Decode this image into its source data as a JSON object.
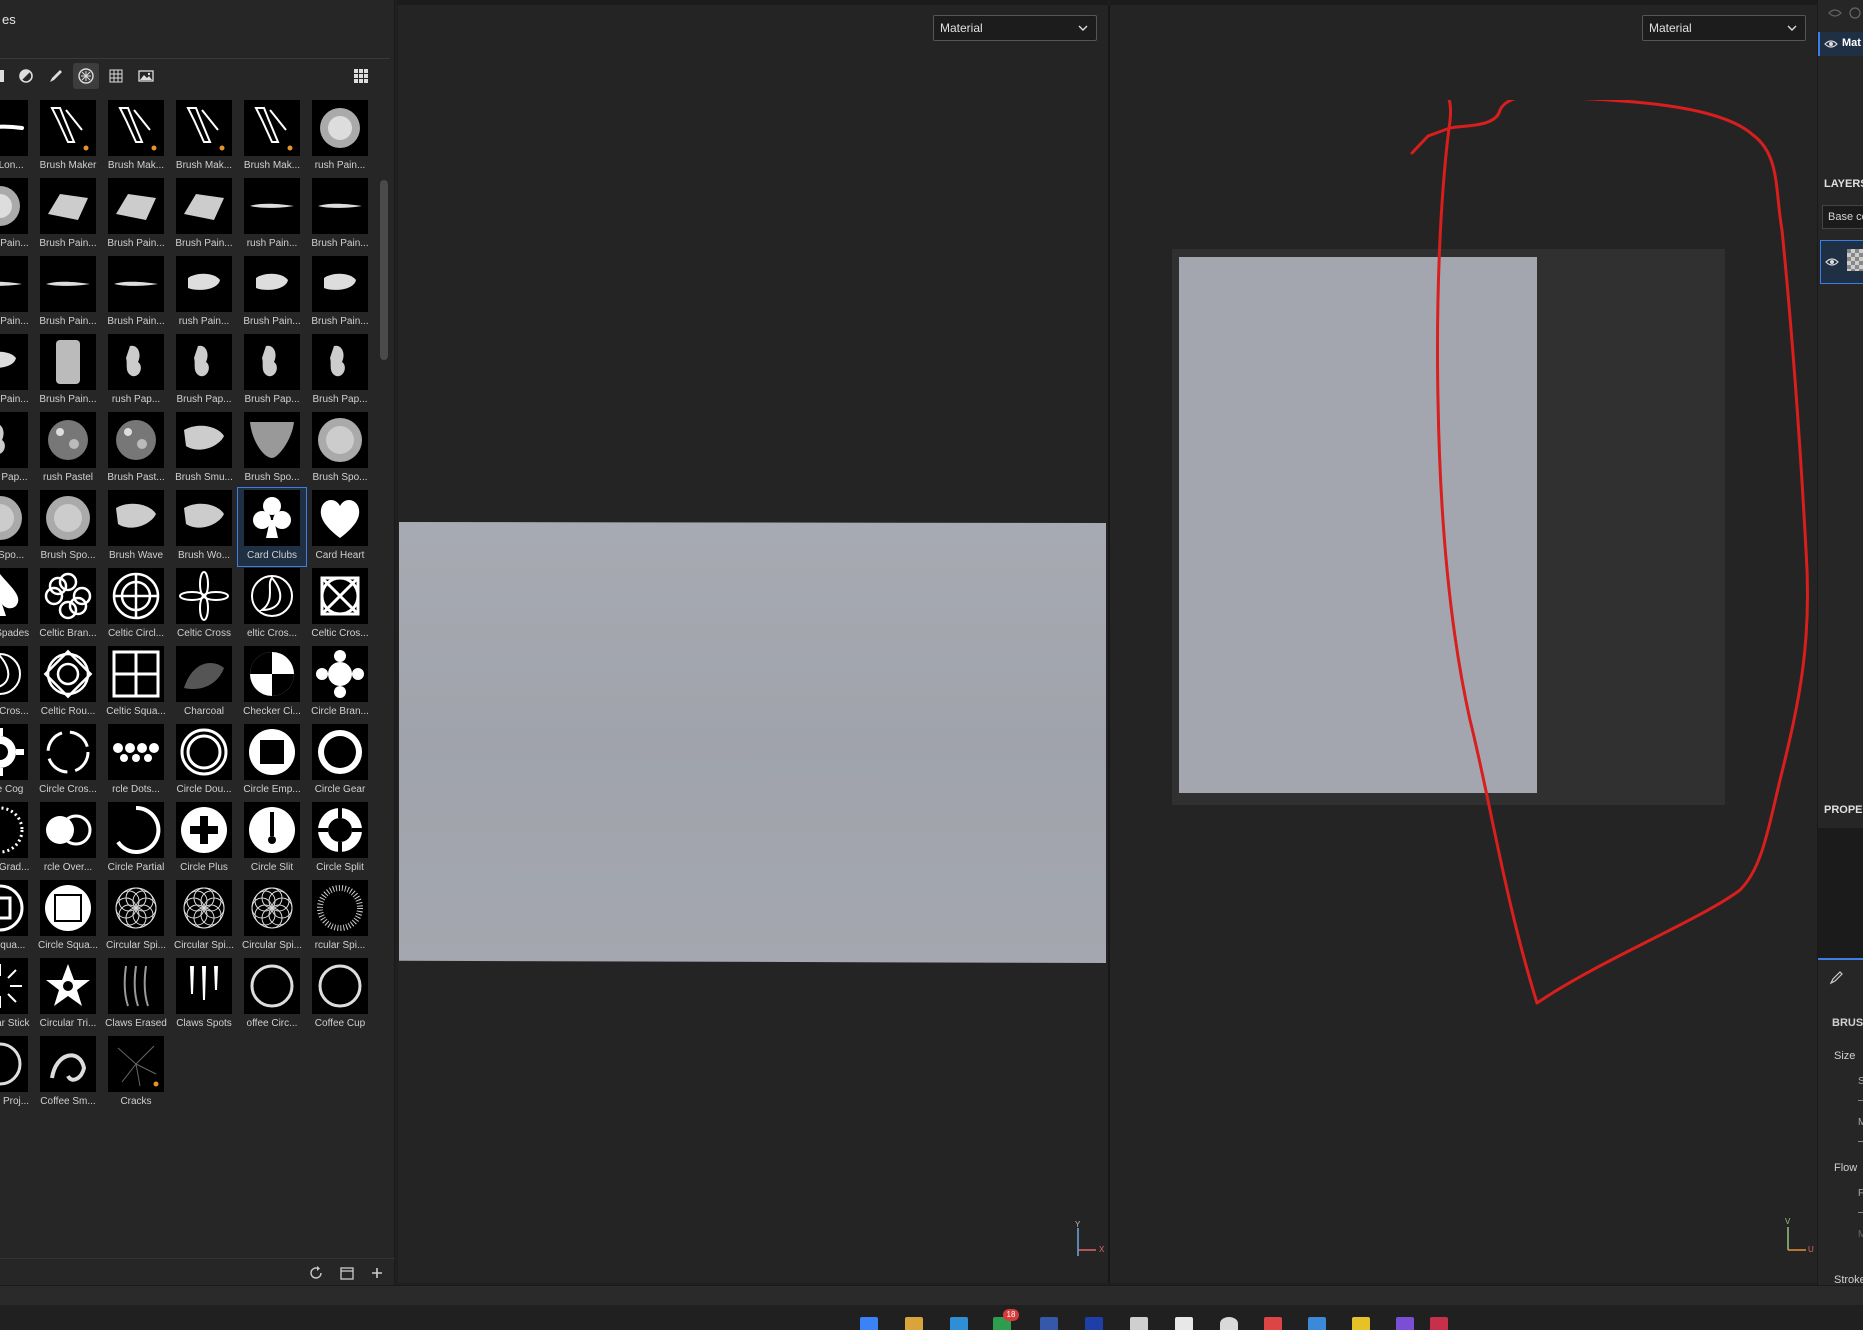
{
  "shelf": {
    "title": "es",
    "toolbar": [
      "material-icon",
      "filter-icon",
      "brush-icon",
      "alpha-icon",
      "grid-pattern-icon",
      "environment-icon"
    ],
    "selected_tile": "Card Clubs",
    "tiles": [
      {
        "label": "rush Lon...",
        "icon": "stroke"
      },
      {
        "label": "Brush Maker",
        "icon": "brushmaker"
      },
      {
        "label": "Brush Mak...",
        "icon": "brushmaker"
      },
      {
        "label": "Brush Mak...",
        "icon": "brushmaker"
      },
      {
        "label": "Brush Mak...",
        "icon": "brushmaker"
      },
      {
        "label": "rush Pain...",
        "icon": "paint-blob"
      },
      {
        "label": "Brush Pain...",
        "icon": "paint-blob"
      },
      {
        "label": "Brush Pain...",
        "icon": "paint-stroke"
      },
      {
        "label": "Brush Pain...",
        "icon": "paint-stroke"
      },
      {
        "label": "Brush Pain...",
        "icon": "paint-stroke"
      },
      {
        "label": "rush Pain...",
        "icon": "thin-stroke"
      },
      {
        "label": "Brush Pain...",
        "icon": "thin-stroke"
      },
      {
        "label": "Brush Pain...",
        "icon": "thin-stroke"
      },
      {
        "label": "Brush Pain...",
        "icon": "thin-stroke"
      },
      {
        "label": "Brush Pain...",
        "icon": "thin-stroke"
      },
      {
        "label": "rush Pain...",
        "icon": "small-blob"
      },
      {
        "label": "Brush Pain...",
        "icon": "small-blob"
      },
      {
        "label": "Brush Pain...",
        "icon": "small-blob"
      },
      {
        "label": "Brush Pain...",
        "icon": "small-blob"
      },
      {
        "label": "Brush Pain...",
        "icon": "tall-blob"
      },
      {
        "label": "rush Pap...",
        "icon": "splat"
      },
      {
        "label": "Brush Pap...",
        "icon": "splat"
      },
      {
        "label": "Brush Pap...",
        "icon": "splat"
      },
      {
        "label": "Brush Pap...",
        "icon": "splat"
      },
      {
        "label": "Brush Pap...",
        "icon": "splat"
      },
      {
        "label": "rush Pastel",
        "icon": "noise"
      },
      {
        "label": "Brush Past...",
        "icon": "noise"
      },
      {
        "label": "Brush Smu...",
        "icon": "smudge"
      },
      {
        "label": "Brush Spo...",
        "icon": "sponge-half"
      },
      {
        "label": "Brush Spo...",
        "icon": "sponge"
      },
      {
        "label": "rush Spo...",
        "icon": "sponge"
      },
      {
        "label": "Brush Spo...",
        "icon": "sponge"
      },
      {
        "label": "Brush Wave",
        "icon": "smudge"
      },
      {
        "label": "Brush Wo...",
        "icon": "smudge"
      },
      {
        "label": "Card Clubs",
        "icon": "club"
      },
      {
        "label": "Card Heart",
        "icon": "heart"
      },
      {
        "label": "Card Spades",
        "icon": "spade"
      },
      {
        "label": "Celtic Bran...",
        "icon": "celtic-flower"
      },
      {
        "label": "Celtic Circl...",
        "icon": "celtic-circle"
      },
      {
        "label": "Celtic Cross",
        "icon": "celtic-star"
      },
      {
        "label": "eltic Cros...",
        "icon": "triquetra"
      },
      {
        "label": "Celtic Cros...",
        "icon": "knot"
      },
      {
        "label": "Celtic Cros...",
        "icon": "triquetra"
      },
      {
        "label": "Celtic Rou...",
        "icon": "knot-round"
      },
      {
        "label": "Celtic Squa...",
        "icon": "squares"
      },
      {
        "label": "Charcoal",
        "icon": "charcoal"
      },
      {
        "label": "Checker Ci...",
        "icon": "checker"
      },
      {
        "label": "Circle Bran...",
        "icon": "circle-branch"
      },
      {
        "label": "Circle Cog",
        "icon": "cog"
      },
      {
        "label": "Circle Cros...",
        "icon": "circle-dashed"
      },
      {
        "label": "rcle Dots...",
        "icon": "dots"
      },
      {
        "label": "Circle Dou...",
        "icon": "double-ring"
      },
      {
        "label": "Circle Emp...",
        "icon": "circle-square"
      },
      {
        "label": "Circle Gear",
        "icon": "ring"
      },
      {
        "label": "Circle Grad...",
        "icon": "dotted-ring"
      },
      {
        "label": "rcle Over...",
        "icon": "overlap"
      },
      {
        "label": "Circle Partial",
        "icon": "partial"
      },
      {
        "label": "Circle Plus",
        "icon": "plus"
      },
      {
        "label": "Circle Slit",
        "icon": "slit"
      },
      {
        "label": "Circle Split",
        "icon": "split"
      },
      {
        "label": "rcle Squa...",
        "icon": "ring-square"
      },
      {
        "label": "Circle Squa...",
        "icon": "ring-square-fill"
      },
      {
        "label": "Circular Spi...",
        "icon": "spiro"
      },
      {
        "label": "Circular Spi...",
        "icon": "spiro"
      },
      {
        "label": "Circular Spi...",
        "icon": "spiro"
      },
      {
        "label": "rcular Spi...",
        "icon": "dot-spiral"
      },
      {
        "label": "Circular Stick",
        "icon": "sticks"
      },
      {
        "label": "Circular Tri...",
        "icon": "star"
      },
      {
        "label": "Claws Erased",
        "icon": "claws"
      },
      {
        "label": "Claws Spots",
        "icon": "claws-spots"
      },
      {
        "label": "offee Circ...",
        "icon": "coffee"
      },
      {
        "label": "Coffee Cup",
        "icon": "coffee"
      },
      {
        "label": "Coffee Proj...",
        "icon": "coffee"
      },
      {
        "label": "Coffee Sm...",
        "icon": "coffee-smudge"
      },
      {
        "label": "Cracks",
        "icon": "cracks"
      }
    ],
    "footer": [
      "refresh-icon",
      "folder-icon",
      "add-icon"
    ]
  },
  "viewport3d": {
    "mode": "Material",
    "axis_labels": [
      "Y",
      "X"
    ]
  },
  "viewport2d": {
    "mode": "Material",
    "axis_labels": [
      "V",
      "U"
    ]
  },
  "annotation_color": "#d91e1e",
  "right_panel": {
    "texture_set_label": "Mat",
    "layers_header": "LAYERS",
    "channel_dropdown": "Base co",
    "properties_header": "PROPE",
    "brush_header": "BRUS",
    "size_label": "Size",
    "size_sub1": "S",
    "size_sub2": "M",
    "flow_label": "Flow",
    "flow_sub1": "F",
    "flow_sub2": "M",
    "stroke_label": "Stroke"
  },
  "taskbar": {
    "badge_count": "18"
  }
}
